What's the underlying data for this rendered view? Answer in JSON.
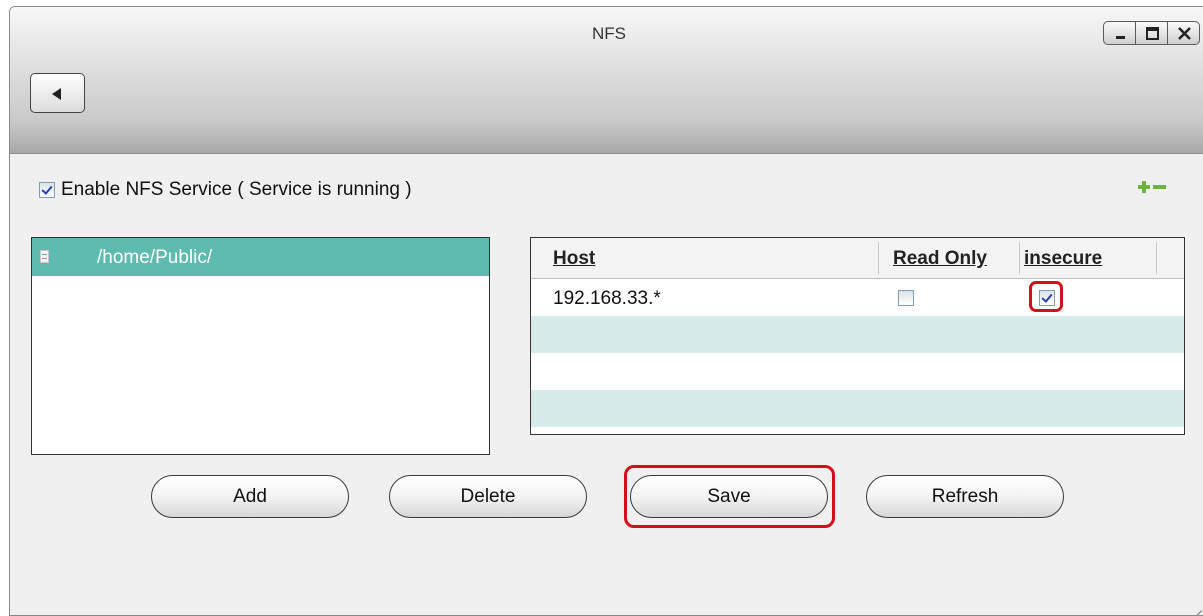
{
  "window": {
    "title": "NFS",
    "controls": [
      "minimize-icon",
      "maximize-icon",
      "close-icon"
    ]
  },
  "enable": {
    "label": "Enable NFS Service ( Service is running )",
    "checked": true
  },
  "shares": [
    {
      "path": "/home/Public/",
      "selected": true
    }
  ],
  "hosts_table": {
    "columns": [
      "Host",
      "Read Only",
      "insecure"
    ],
    "rows": [
      {
        "host": "192.168.33.*",
        "read_only": false,
        "insecure": true
      }
    ]
  },
  "buttons": {
    "add": "Add",
    "delete": "Delete",
    "save": "Save",
    "refresh": "Refresh"
  },
  "colors": {
    "selected_row": "#5fbab0",
    "alt_row": "#d7ebea",
    "highlight": "#d0101a",
    "add_remove_icons": "#6db33f"
  }
}
